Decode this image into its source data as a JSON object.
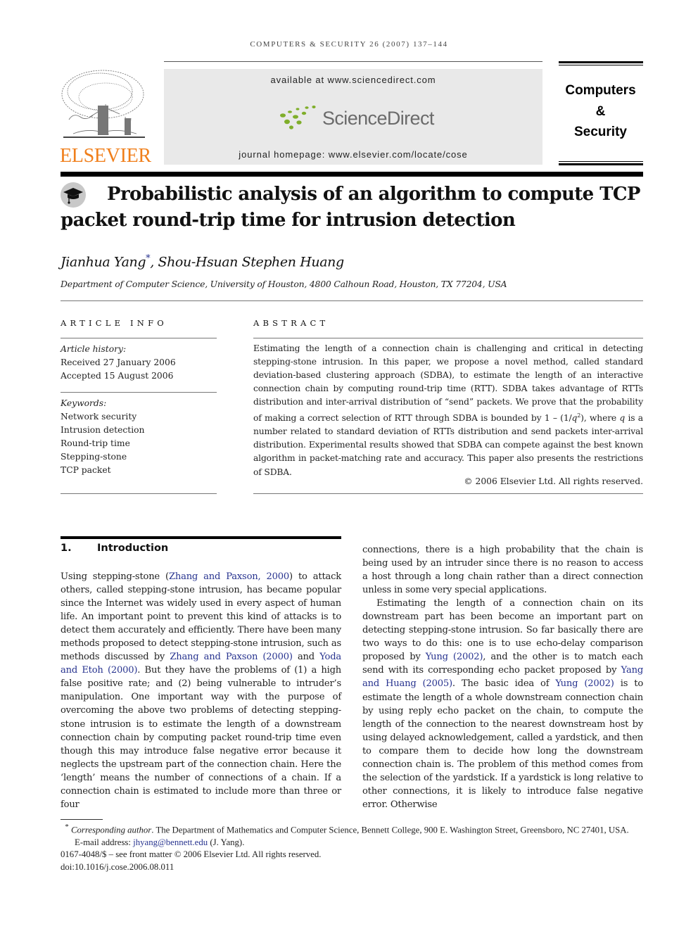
{
  "header": {
    "running_head": "COMPUTERS & SECURITY 26 (2007) 137–144",
    "available_at": "available at www.sciencedirect.com",
    "sciencedirect_logo": "ScienceDirect",
    "journal_homepage": "journal homepage: www.elsevier.com/locate/cose",
    "publisher_logo": "ELSEVIER",
    "journal_name_lines": [
      "Computers",
      "&",
      "Security"
    ],
    "colors": {
      "elsevier_orange": "#f07f1b",
      "sciencedirect_green": "#7fae2a",
      "link_blue": "#27338f",
      "banner_gray": "#e9e9e9"
    }
  },
  "article": {
    "icon": "graduation-cap-icon",
    "title_line1": "Probabilistic analysis of an algorithm to compute TCP",
    "title_line2": "packet round-trip time for intrusion detection",
    "author1": "Jianhua Yang",
    "author1_mark": "*",
    "author_sep": ", ",
    "author2": "Shou-Hsuan Stephen Huang",
    "affiliation": "Department of Computer Science, University of Houston, 4800 Calhoun Road, Houston, TX 77204, USA"
  },
  "article_info": {
    "label": "ARTICLE INFO",
    "history_label": "Article history:",
    "received": "Received 27 January 2006",
    "accepted": "Accepted 15 August 2006",
    "keywords_label": "Keywords:",
    "keywords": [
      "Network security",
      "Intrusion detection",
      "Round-trip time",
      "Stepping-stone",
      "TCP packet"
    ]
  },
  "abstract": {
    "label": "ABSTRACT",
    "text_part1": "Estimating the length of a connection chain is challenging and critical in detecting stepping-stone intrusion. In this paper, we propose a novel method, called standard deviation-based clustering approach (SDBA), to estimate the length of an interactive connection chain by computing round-trip time (RTT). SDBA takes advantage of RTTs distribution and inter-arrival distribution of “send” packets. We prove that the probability of making a correct selection of RTT through SDBA is bounded by 1 – (1/",
    "q_var": "q",
    "q_exp": "2",
    "text_part2": "), where ",
    "text_part3": " is a number related to standard deviation of RTTs distribution and send packets inter-arrival distribution. Experimental results showed that SDBA can compete against the best known algorithm in packet-matching rate and accuracy. This paper also presents the restrictions of SDBA.",
    "copyright": "© 2006 Elsevier Ltd. All rights reserved."
  },
  "section1": {
    "number": "1.",
    "title": "Introduction",
    "left_col": {
      "p1_a": "Using stepping-stone (",
      "cite1": "Zhang and Paxson, 2000",
      "p1_b": ") to attack others, called stepping-stone intrusion, has became popular since the Internet was widely used in every aspect of human life. An important point to prevent this kind of attacks is to detect them accurately and efficiently. There have been many methods proposed to detect stepping-stone intrusion, such as methods discussed by ",
      "cite2": "Zhang and Paxson (2000)",
      "p1_c": " and ",
      "cite3": "Yoda and Etoh (2000)",
      "p1_d": ". But they have the problems of (1) a high false positive rate; and (2) being vulnerable to intruder’s manipulation. One important way with the purpose of overcoming the above two problems of detecting stepping-stone intrusion is to estimate the length of a downstream connection chain by computing packet round-trip time even though this may introduce false negative error because it neglects the upstream part of the connection chain. Here the ‘length’ means the number of connections of a chain. If a connection chain is estimated to include more than three or four"
    },
    "right_col": {
      "p1": "connections, there is a high probability that the chain is being used by an intruder since there is no reason to access a host through a long chain rather than a direct connection unless in some very special applications.",
      "p2_a": "Estimating the length of a connection chain on its downstream part has been become an important part on detecting stepping-stone intrusion. So far basically there are two ways to do this: one is to use echo-delay comparison proposed by ",
      "cite1": "Yung (2002)",
      "p2_b": ", and the other is to match each send with its corresponding echo packet proposed by ",
      "cite2": "Yang and Huang (2005)",
      "p2_c": ". The basic idea of ",
      "cite3": "Yung (2002)",
      "p2_d": " is to estimate the length of a whole downstream connection chain by using reply echo packet on the chain, to compute the length of the connection to the nearest downstream host by using delayed acknowledgement, called a yardstick, and then to compare them to decide how long the downstream connection chain is. The problem of this method comes from the selection of the yardstick. If a yardstick is long relative to other connections, it is likely to introduce false negative error. Otherwise"
    }
  },
  "footnotes": {
    "mark": "*",
    "corr_label": "Corresponding author",
    "corr_text": ". The Department of Mathematics and Computer Science, Bennett College, 900 E. Washington Street, Greensboro, NC 27401, USA.",
    "email_label": "E-mail address: ",
    "email": "jhyang@bennett.edu",
    "email_suffix": " (J. Yang).",
    "front_matter": "0167-4048/$ – see front matter © 2006 Elsevier Ltd. All rights reserved.",
    "doi": "doi:10.1016/j.cose.2006.08.011"
  }
}
